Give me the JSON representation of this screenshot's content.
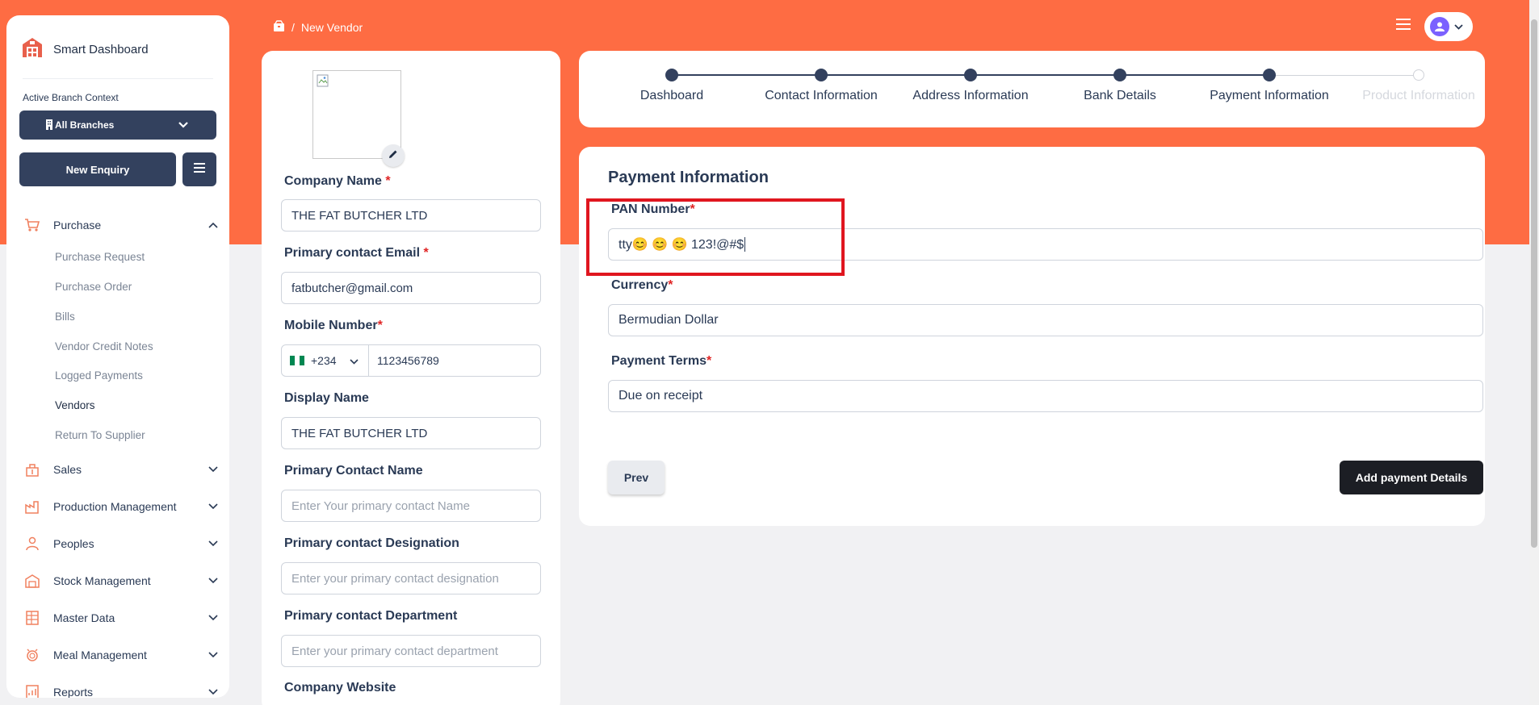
{
  "sidebar": {
    "brand": "Smart Dashboard",
    "context_label": "Active Branch Context",
    "branch_select": "All Branches",
    "new_enquiry": "New Enquiry",
    "groups": [
      {
        "label": "Purchase",
        "icon": "cart-icon",
        "expanded": true
      },
      {
        "label": "Sales",
        "icon": "sales-icon"
      },
      {
        "label": "Production Management",
        "icon": "factory-icon"
      },
      {
        "label": "Peoples",
        "icon": "people-icon"
      },
      {
        "label": "Stock Management",
        "icon": "warehouse-icon"
      },
      {
        "label": "Master Data",
        "icon": "database-icon"
      },
      {
        "label": "Meal Management",
        "icon": "meal-icon"
      },
      {
        "label": "Reports",
        "icon": "report-icon"
      }
    ],
    "purchase_items": [
      {
        "label": "Purchase Request"
      },
      {
        "label": "Purchase Order"
      },
      {
        "label": "Bills"
      },
      {
        "label": "Vendor Credit Notes"
      },
      {
        "label": "Logged Payments"
      },
      {
        "label": "Vendors",
        "active": true
      },
      {
        "label": "Return To Supplier"
      }
    ]
  },
  "breadcrumb": {
    "separator": "/",
    "current": "New Vendor"
  },
  "vendor_form": {
    "company_name_label": "Company Name",
    "company_name": "THE FAT BUTCHER LTD",
    "email_label": "Primary contact Email",
    "email": "fatbutcher@gmail.com",
    "mobile_label": "Mobile Number",
    "country_code": "+234",
    "mobile": "1123456789",
    "display_name_label": "Display Name",
    "display_name": "THE FAT BUTCHER LTD",
    "contact_name_label": "Primary Contact Name",
    "contact_name_placeholder": "Enter Your primary contact Name",
    "designation_label": "Primary contact Designation",
    "designation_placeholder": "Enter your primary contact designation",
    "department_label": "Primary contact Department",
    "department_placeholder": "Enter your primary contact department",
    "website_label": "Company Website",
    "required_mark": "*"
  },
  "stepper": {
    "steps": [
      {
        "label": "Dashboard",
        "done": true
      },
      {
        "label": "Contact Information",
        "done": true
      },
      {
        "label": "Address Information",
        "done": true
      },
      {
        "label": "Bank Details",
        "done": true
      },
      {
        "label": "Payment Information",
        "done": true
      },
      {
        "label": "Product Information",
        "done": false
      }
    ]
  },
  "payment": {
    "title": "Payment Information",
    "pan_label": "PAN Number",
    "pan_value": "tty😊 😊 😊 123!@#$",
    "currency_label": "Currency",
    "currency_value": "Bermudian Dollar",
    "terms_label": "Payment Terms",
    "terms_value": "Due on receipt",
    "prev_button": "Prev",
    "add_button": "Add payment Details"
  },
  "colors": {
    "brand_orange": "#fe6c43",
    "navy": "#33415e",
    "highlight_red": "#e0161f",
    "dark_button": "#1c1e24"
  }
}
